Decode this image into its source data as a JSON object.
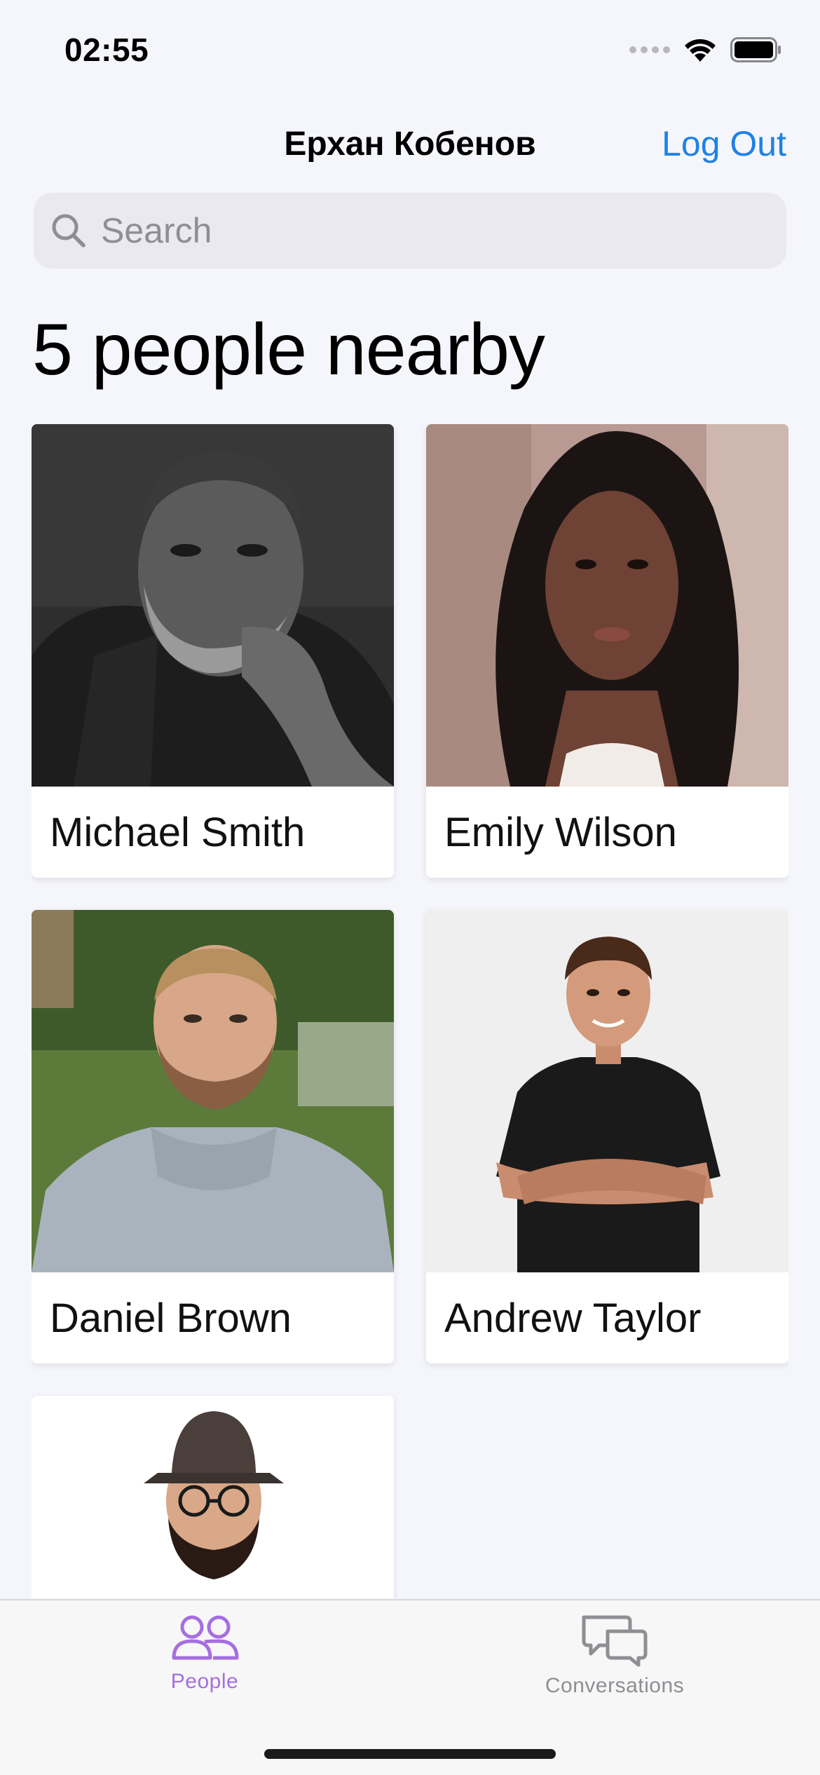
{
  "status_bar": {
    "time": "02:55"
  },
  "nav": {
    "title": "Ерхан Кобенов",
    "logout_label": "Log Out"
  },
  "search": {
    "placeholder": "Search",
    "icon": "magnifying-glass-icon"
  },
  "main": {
    "heading": "5 people nearby",
    "people": [
      {
        "name": "Michael Smith",
        "photo": "older-man-portrait"
      },
      {
        "name": "Emily Wilson",
        "photo": "young-woman-portrait"
      },
      {
        "name": "Daniel Brown",
        "photo": "bearded-man-hoodie-portrait"
      },
      {
        "name": "Andrew Taylor",
        "photo": "man-crossed-arms-portrait"
      },
      {
        "name": "",
        "photo": "man-hat-glasses-portrait"
      }
    ]
  },
  "tabbar": {
    "tabs": [
      {
        "label": "People",
        "icon": "people-icon",
        "active": true
      },
      {
        "label": "Conversations",
        "icon": "chat-bubbles-icon",
        "active": false
      }
    ]
  },
  "colors": {
    "accent": "#1e82e6",
    "active_tab": "#a66ee0",
    "inactive_tab": "#8e8e93",
    "background": "#f5f6fb"
  }
}
